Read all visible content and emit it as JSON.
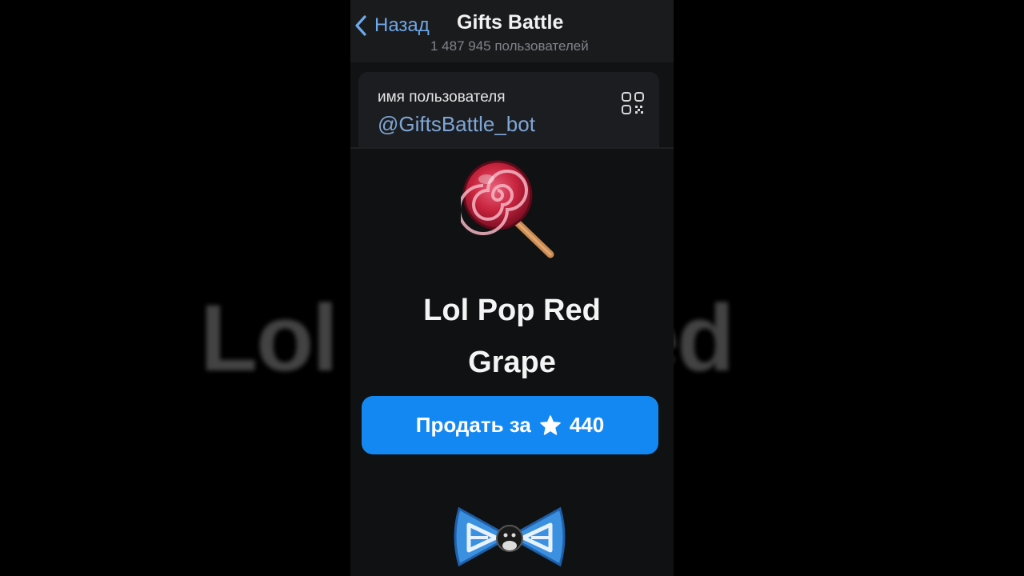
{
  "background": {
    "echo_text": "Lol Pop Red"
  },
  "header": {
    "back_label": "Назад",
    "title": "Gifts Battle",
    "subtitle": "1 487 945 пользователей"
  },
  "username_card": {
    "label": "имя пользователя",
    "value": "@GiftsBattle_bot",
    "qr_icon": "qr-code-icon"
  },
  "gift": {
    "title_line1": "Lol Pop Red",
    "title_line2": "Grape",
    "icon": "lollipop-icon",
    "sell_label": "Продать за",
    "price": "440",
    "currency_icon": "star-icon",
    "next_gift_icon": "bow-tie-icon"
  },
  "colors": {
    "accent": "#1488f2",
    "link": "#7ea6d6",
    "back": "#6fa8e8"
  }
}
